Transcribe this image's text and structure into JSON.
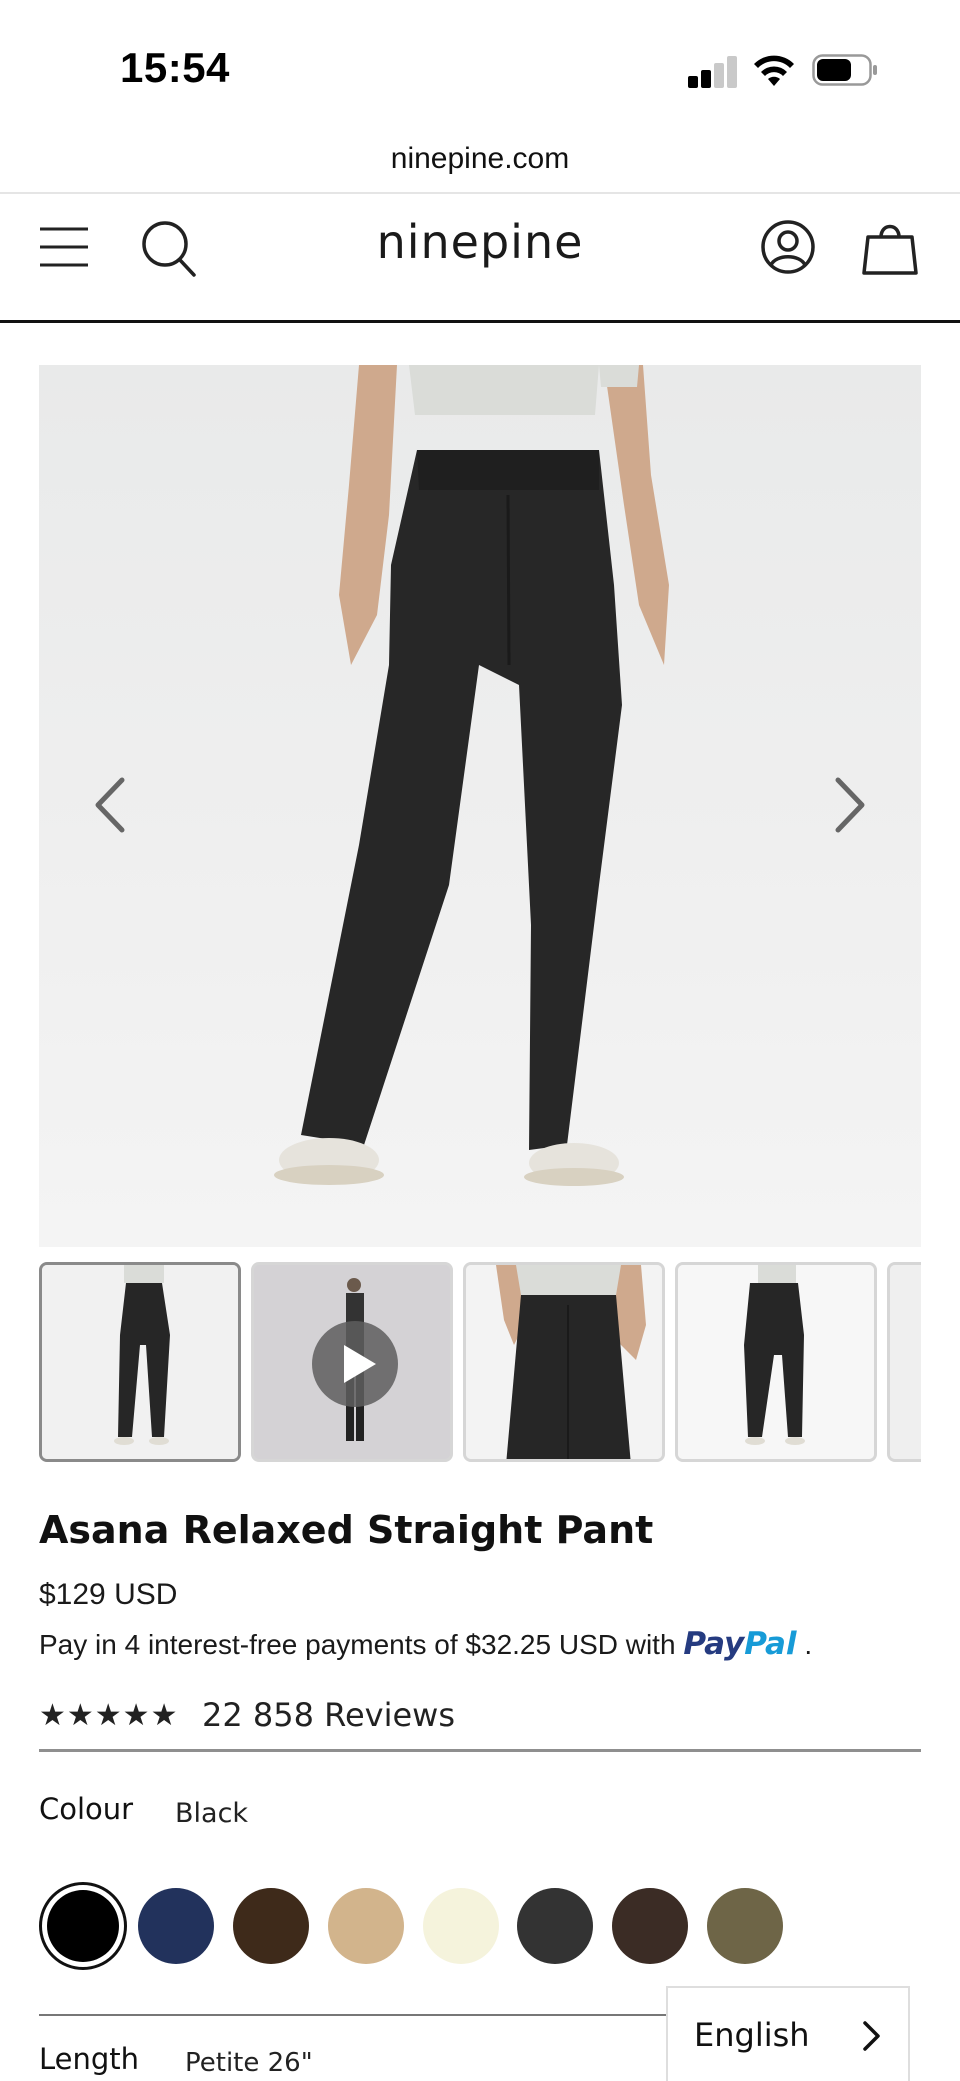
{
  "status_bar": {
    "time": "15:54",
    "signal_icon": "cellular-signal-icon",
    "wifi_icon": "wifi-icon",
    "battery_icon": "battery-icon"
  },
  "browser": {
    "url": "ninepine.com"
  },
  "header": {
    "logo": "ninepine",
    "icons": [
      "menu-icon",
      "search-icon",
      "account-icon",
      "shopping-bag-icon"
    ]
  },
  "gallery": {
    "prev_icon": "chevron-left-icon",
    "next_icon": "chevron-right-icon",
    "thumbnails": [
      {
        "kind": "image",
        "active": true
      },
      {
        "kind": "video",
        "icon": "play-icon"
      },
      {
        "kind": "image"
      },
      {
        "kind": "image"
      },
      {
        "kind": "image"
      }
    ]
  },
  "product": {
    "title": "Asana Relaxed Straight Pant",
    "price": "$129 USD",
    "paypal": {
      "prefix": "Pay in 4 interest-free payments of $32.25 USD with",
      "logo_pay": "Pay",
      "logo_pal": "Pal",
      "suffix": "."
    },
    "rating": {
      "stars": "★★★★★",
      "stars_value": 5,
      "reviews": "22 858 Reviews"
    },
    "colour": {
      "label": "Colour",
      "value": "Black",
      "swatches": [
        {
          "name": "black",
          "color": "#000000",
          "selected": true
        },
        {
          "name": "navy",
          "color": "#22325c"
        },
        {
          "name": "brown",
          "color": "#3e2a1a"
        },
        {
          "name": "sand",
          "color": "#d2b48c"
        },
        {
          "name": "cream",
          "color": "#f5f3dc"
        },
        {
          "name": "charcoal",
          "color": "#333333"
        },
        {
          "name": "espresso",
          "color": "#3b2c25"
        },
        {
          "name": "olive",
          "color": "#6e6547"
        }
      ]
    },
    "length": {
      "label": "Length",
      "value": "Petite 26\""
    }
  },
  "language": {
    "label": "English",
    "icon": "chevron-right-icon"
  }
}
